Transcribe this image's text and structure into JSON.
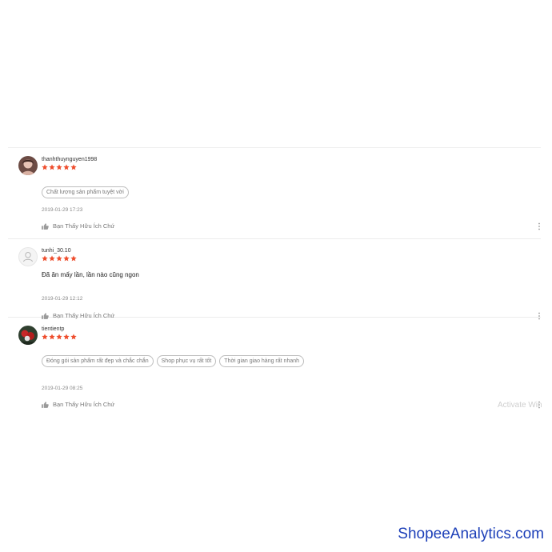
{
  "colors": {
    "star": "#ee4d2d",
    "brand_watermark": "#1c3fb8",
    "tag_border": "#bdbdbd",
    "muted_text": "#777777"
  },
  "reviews": [
    {
      "username": "thanhthuynguyen1998",
      "rating": 5,
      "avatar_icon": "user-photo-avatar",
      "tags": [
        "Chất lượng sản phẩm tuyệt vời"
      ],
      "text": "",
      "timestamp": "2019-01-29 17:23",
      "helpful_label": "Bạn Thấy Hữu Ích Chứ",
      "helpful_icon": "thumbs-up-icon",
      "more_icon": "more-options-icon"
    },
    {
      "username": "tunhi_30.10",
      "rating": 5,
      "avatar_icon": "default-user-avatar",
      "tags": [],
      "text": "Đã ăn mấy lần, lần nào cũng ngon",
      "timestamp": "2019-01-29 12:12",
      "helpful_label": "Bạn Thấy Hữu Ích Chứ",
      "helpful_icon": "thumbs-up-icon",
      "more_icon": "more-options-icon"
    },
    {
      "username": "tientientp",
      "rating": 5,
      "avatar_icon": "user-photo-avatar",
      "tags": [
        "Đóng gói sản phẩm rất đẹp và chắc chắn",
        "Shop phục vụ rất tốt",
        "Thời gian giao hàng rất nhanh"
      ],
      "text": "",
      "timestamp": "2019-01-29 08:25",
      "helpful_label": "Bạn Thấy Hữu Ích Chứ",
      "helpful_icon": "thumbs-up-icon",
      "more_icon": "more-options-icon"
    }
  ],
  "watermarks": {
    "windows_activation": "Activate Win",
    "brand": "ShopeeAnalytics.com"
  }
}
